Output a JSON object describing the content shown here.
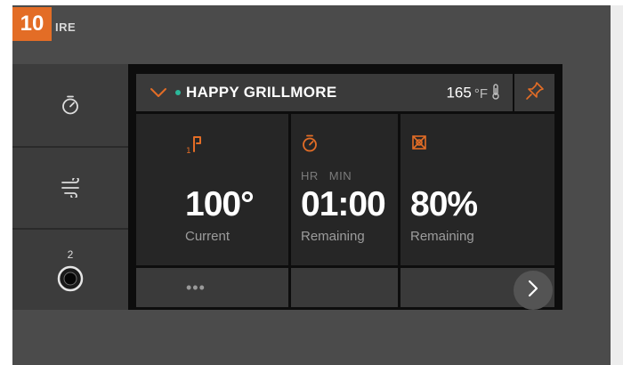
{
  "step_badge": "10",
  "brand_fragment": "IRE",
  "side_nav": {
    "items": [
      {
        "icon": "timer-icon"
      },
      {
        "icon": "smoke-icon"
      },
      {
        "icon": "probe-port-icon",
        "label": "2"
      }
    ]
  },
  "header": {
    "grill_name": "HAPPY GRILLMORE",
    "status_color": "#2bb89a",
    "temp_value": "165",
    "temp_unit": "°F",
    "icons": [
      "chevron-down-icon",
      "thermometer-icon",
      "pin-icon"
    ]
  },
  "cards": [
    {
      "icon": "probe-icon",
      "value": "100°",
      "label": "Current"
    },
    {
      "icon": "timer-icon",
      "hr_label": "HR",
      "min_label": "MIN",
      "value": "01:00",
      "label": "Remaining"
    },
    {
      "icon": "pellet-icon",
      "value": "80%",
      "label": "Remaining"
    }
  ],
  "footer": {
    "more_label": "•••",
    "next_icon": "chevron-right-icon"
  },
  "colors": {
    "accent": "#e36d26",
    "panel_bg": "#3a3a3a",
    "card_bg": "#262626",
    "screen_bg": "#0d0d0d"
  }
}
